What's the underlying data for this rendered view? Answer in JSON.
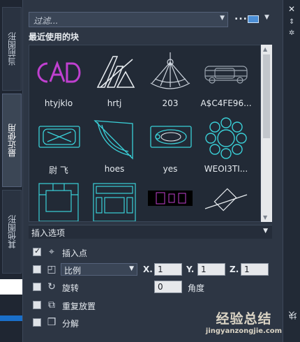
{
  "left_tabs": [
    "当前图形",
    "最近使用",
    "其他图形"
  ],
  "filter": {
    "placeholder": "过滤...",
    "more": "..."
  },
  "section_title": "最近使用的块",
  "blocks": [
    {
      "label": "htyjklo"
    },
    {
      "label": "hrtj"
    },
    {
      "label": "203"
    },
    {
      "label": "A$C4FE96..."
    },
    {
      "label": "尉 飞"
    },
    {
      "label": "hoes"
    },
    {
      "label": "yes"
    },
    {
      "label": "WEOI3TI..."
    },
    {
      "label": ""
    },
    {
      "label": ""
    },
    {
      "label": ""
    },
    {
      "label": ""
    }
  ],
  "insert_options": {
    "title": "插入选项",
    "insertion_point": {
      "label": "插入点",
      "checked": true
    },
    "scale": {
      "mode": "比例",
      "checked": false,
      "x_label": "X.",
      "x": "1",
      "y_label": "Y.",
      "y": "1",
      "z_label": "Z.",
      "z": "1"
    },
    "rotation": {
      "label": "旋转",
      "angle": "0",
      "angle_label": "角度",
      "checked": false
    },
    "repeat": {
      "label": "重复放置",
      "checked": false
    },
    "explode": {
      "label": "分解",
      "checked": false
    }
  },
  "right_strip": {
    "close": "✕",
    "title": "块"
  },
  "watermark": {
    "text": "经验总结",
    "url": "jingyanzongjie.com"
  },
  "colors": {
    "accent": "#4c8fd6",
    "magenta": "#c040d0",
    "cyan": "#3ad0d8",
    "panel": "#2d3644"
  }
}
